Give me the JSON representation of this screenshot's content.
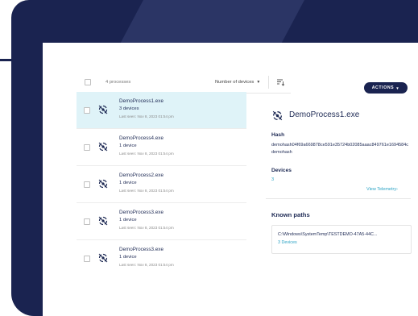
{
  "list": {
    "process_count": "4 processes",
    "sort_label": "Number of devices",
    "rows": [
      {
        "name": "DemoProcess1.exe",
        "devices": "3 devices",
        "last_seen": "Last seen: Nov 8, 2023 01:54 pm"
      },
      {
        "name": "DemoProcess4.exe",
        "devices": "1 device",
        "last_seen": "Last seen: Nov 8, 2023 01:54 pm"
      },
      {
        "name": "DemoProcess2.exe",
        "devices": "1 device",
        "last_seen": "Last seen: Nov 8, 2023 01:54 pm"
      },
      {
        "name": "DemoProcess3.exe",
        "devices": "1 device",
        "last_seen": "Last seen: Nov 8, 2023 01:54 pm"
      },
      {
        "name": "DemoProcess3.exe",
        "devices": "1 device",
        "last_seen": "Last seen: Nov 8, 2023 01:54 pm"
      }
    ]
  },
  "detail": {
    "actions_label": "ACTIONS",
    "title": "DemoProcess1.exe",
    "hash_label": "Hash",
    "hash_value": "demohash04f69a669878ce591e35724b02085aaac849761e1694584cdemohash",
    "devices_label": "Devices",
    "devices_value": "3",
    "telemetry_link": "View Telemetry",
    "known_paths_label": "Known paths",
    "path": "C:\\Windows\\SystemTemp\\TESTDEMO-47A5-44C...",
    "path_devices": "3 Devices"
  },
  "colors": {
    "navy": "#1a2350",
    "accent": "#2aa2c4",
    "selected_row": "#dff3f8"
  },
  "icons": {
    "process": "process-icon",
    "sort": "sort-icon",
    "caret": "caret-down-icon"
  }
}
